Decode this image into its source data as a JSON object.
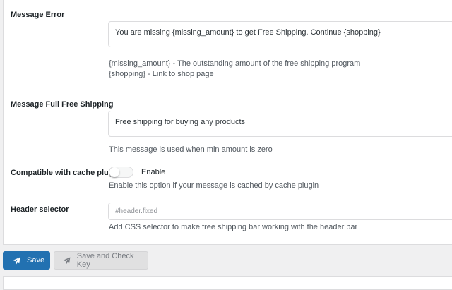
{
  "fields": {
    "message_error": {
      "label": "Message Error",
      "value": "You are missing {missing_amount} to get Free Shipping. Continue {shopping}",
      "help_lines": [
        "{missing_amount} - The outstanding amount of the free shipping program",
        "{shopping} - Link to shop page"
      ]
    },
    "message_full": {
      "label": "Message Full Free Shipping",
      "value": "Free shipping for buying any products",
      "help": "This message is used when min amount is zero"
    },
    "cache_plugin": {
      "label": "Compatible with cache plugin",
      "toggle_label": "Enable",
      "enabled": false,
      "help": "Enable this option if your message is cached by cache plugin"
    },
    "header_selector": {
      "label": "Header selector",
      "placeholder": "#header.fixed",
      "value": "",
      "help": "Add CSS selector to make free shipping bar working with the header bar"
    }
  },
  "actions": {
    "save_label": "Save",
    "save_check_label": "Save and Check Key",
    "icon": "paper-plane-icon"
  },
  "colors": {
    "primary": "#2271b1",
    "disabled_button": "#e0e0e1",
    "border": "#dcdcde"
  }
}
